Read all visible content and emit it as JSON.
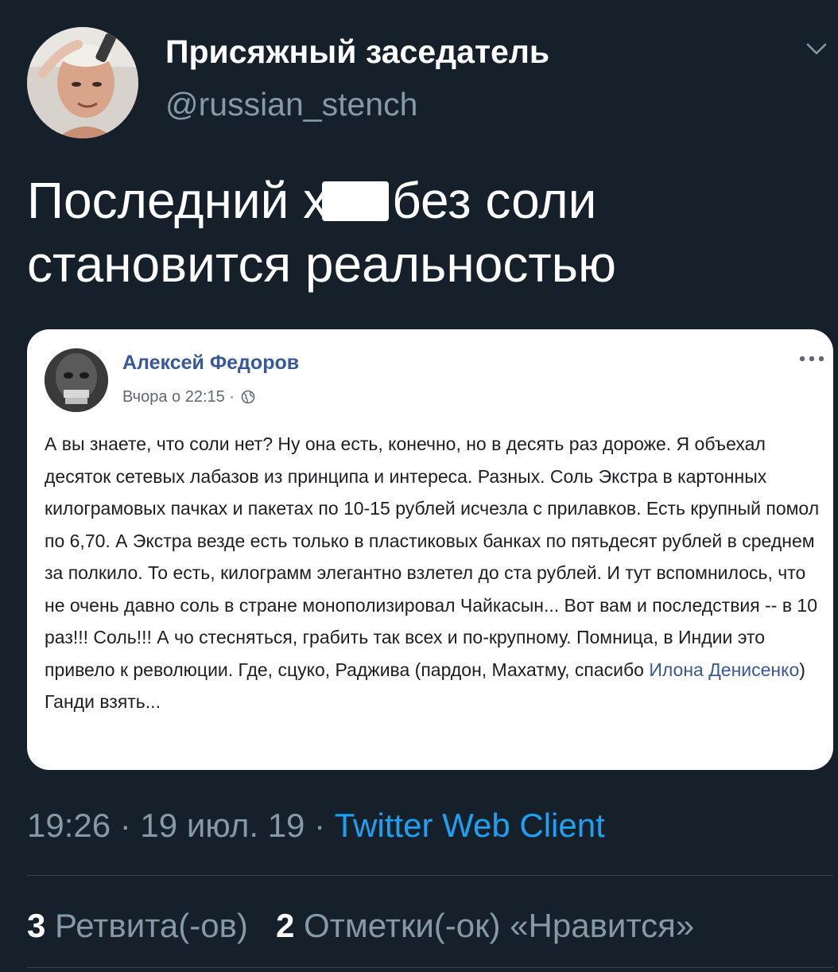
{
  "tweet": {
    "author": {
      "display_name": "Присяжный заседатель",
      "handle": "@russian_stench"
    },
    "text_part1": "Последний х",
    "text_part2": "без соли",
    "text_part3": "становится реальностью",
    "timestamp": "19:26 · 19 июл. 19 · ",
    "source": "Twitter Web Client",
    "retweets_count": "3",
    "retweets_label": " Ретвита(-ов)",
    "likes_count": "2",
    "likes_label": " Отметки(-ок) «Нравится»"
  },
  "embedded_post": {
    "author": "Алексей Федоров",
    "meta": "Вчора о 22:15 ·",
    "body": "А вы знаете, что соли нет? Ну она есть, конечно, но в десять раз дороже. Я объехал десяток сетевых лабазов из принципа и интереса. Разных. Соль Экстра в картонных килограмовых пачках и пакетах по 10-15 рублей исчезла с прилавков. Есть крупный помол по 6,70. А Экстра везде есть только в пластиковых банках по пятьдесят рублей в среднем за полкило. То есть, килограмм элегантно взлетел до ста рублей. И тут вспомнилось, что не очень давно соль в стране монополизировал Чайкасын... Вот вам и последствия -- в 10 раз!!! Соль!!! А чо стесняться, грабить так всех и по-крупному. Помница, в Индии это привело к революции. Где, сцуко, Раджива (пардон, Махатму, спасибо ",
    "mention": "Илона Денисенко",
    "body_end": ") Ганди взять..."
  },
  "colors": {
    "background": "#15202b",
    "accent": "#1da1f2",
    "secondary_text": "#8899a6",
    "fb_link": "#385898"
  },
  "icons": [
    "chevron-down-icon",
    "globe-icon",
    "more-options-icon"
  ]
}
